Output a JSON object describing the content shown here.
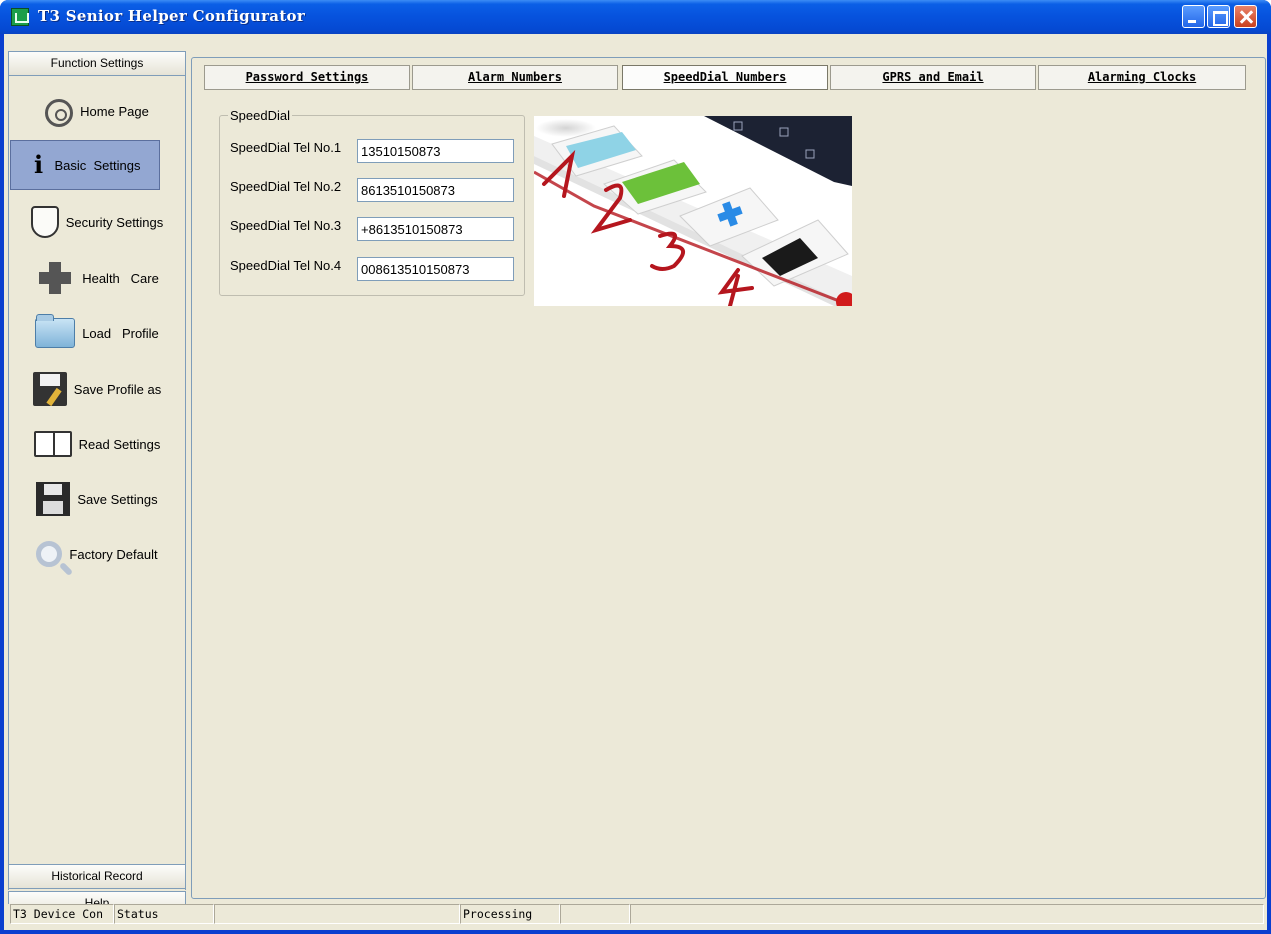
{
  "window": {
    "title": "T3 Senior Helper Configurator"
  },
  "sidebar": {
    "header": "Function Settings",
    "items": [
      {
        "label": "Home Page",
        "icon": "gear-icon"
      },
      {
        "label": "Basic  Settings",
        "icon": "info-icon",
        "active": true
      },
      {
        "label": "Security Settings",
        "icon": "shield-icon"
      },
      {
        "label": "Health   Care",
        "icon": "medical-cross-icon"
      },
      {
        "label": "Load   Profile",
        "icon": "folder-icon"
      },
      {
        "label": "Save Profile as",
        "icon": "save-as-icon"
      },
      {
        "label": "Read Settings",
        "icon": "book-icon"
      },
      {
        "label": "Save Settings",
        "icon": "floppy-icon"
      },
      {
        "label": "Factory Default",
        "icon": "magnifier-icon"
      }
    ],
    "footer_items": [
      "Historical Record",
      "Help"
    ]
  },
  "tabs": [
    {
      "label": "Password Settings"
    },
    {
      "label": "Alarm Numbers"
    },
    {
      "label": "SpeedDial Numbers",
      "active": true
    },
    {
      "label": "GPRS and Email"
    },
    {
      "label": "Alarming Clocks"
    }
  ],
  "speeddial": {
    "group_title": "SpeedDial",
    "fields": [
      {
        "label": "SpeedDial Tel No.1",
        "value": "13510150873"
      },
      {
        "label": "SpeedDial Tel No.2",
        "value": "8613510150873"
      },
      {
        "label": "SpeedDial Tel No.3",
        "value": "+8613510150873"
      },
      {
        "label": "SpeedDial Tel No.4",
        "value": "008613510150873"
      }
    ],
    "illustration": {
      "button_numbers": [
        "1",
        "2",
        "3",
        "4"
      ],
      "button_colors": [
        "#8fd3e6",
        "#6cc13a",
        "#ffffff",
        "#ffffff"
      ]
    }
  },
  "statusbar": {
    "cells": [
      "T3 Device Con",
      "Status",
      "",
      "Processing",
      "",
      ""
    ]
  }
}
